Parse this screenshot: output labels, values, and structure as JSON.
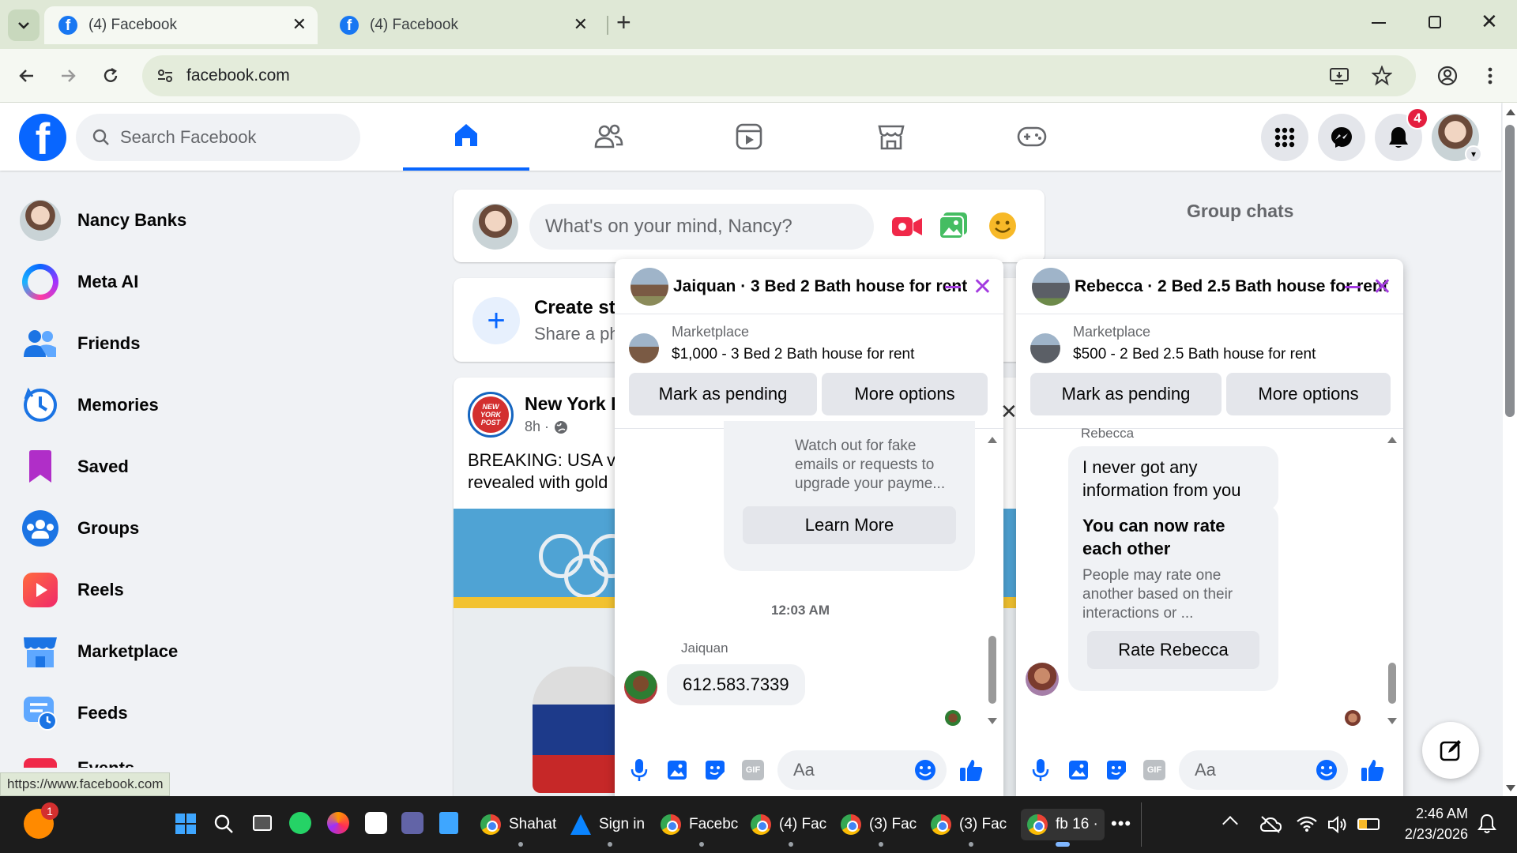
{
  "browser": {
    "tabs": [
      {
        "title": "(4) Facebook",
        "active": true
      },
      {
        "title": "(4) Facebook",
        "active": false
      }
    ],
    "new_tab": "+",
    "url": "facebook.com",
    "status_url": "https://www.facebook.com"
  },
  "fb": {
    "search_placeholder": "Search Facebook",
    "notifications_count": "4",
    "nav_tabs": [
      "home-icon",
      "friends-icon",
      "video-icon",
      "marketplace-icon",
      "gaming-icon"
    ]
  },
  "sidebar": {
    "items": [
      {
        "label": "Nancy Banks",
        "icon": "avatar"
      },
      {
        "label": "Meta AI",
        "icon": "meta-ai-icon"
      },
      {
        "label": "Friends",
        "icon": "friends-icon"
      },
      {
        "label": "Memories",
        "icon": "memories-icon"
      },
      {
        "label": "Saved",
        "icon": "saved-icon"
      },
      {
        "label": "Groups",
        "icon": "groups-icon"
      },
      {
        "label": "Reels",
        "icon": "reels-icon"
      },
      {
        "label": "Marketplace",
        "icon": "marketplace-icon"
      },
      {
        "label": "Feeds",
        "icon": "feeds-icon"
      },
      {
        "label": "Events",
        "icon": "events-icon"
      }
    ]
  },
  "composer": {
    "placeholder": "What's on your mind, Nancy?"
  },
  "story": {
    "title": "Create st",
    "subtitle": "Share a ph"
  },
  "post": {
    "author": "New York P",
    "time": "8h ·",
    "text_line1": "BREAKING: USA vs.",
    "text_line2": "revealed with gold",
    "logo_text": "NEW YORK POST"
  },
  "right_panel": {
    "group_chats": "Group chats"
  },
  "chat1": {
    "title": "Jaiquan · 3 Bed 2 Bath house for rent",
    "market_label": "Marketplace",
    "listing": "$1,000 - 3 Bed 2 Bath house for rent",
    "mark_pending": "Mark as pending",
    "more_options": "More options",
    "warning_text": "Watch out for fake emails or requests to upgrade your payme...",
    "learn_more": "Learn More",
    "timestamp": "12:03 AM",
    "sender": "Jaiquan",
    "message": "612.583.7339",
    "input_placeholder": "Aa"
  },
  "chat2": {
    "title": "Rebecca · 2 Bed 2.5 Bath house for rent",
    "market_label": "Marketplace",
    "listing": "$500 - 2 Bed 2.5 Bath house for rent",
    "mark_pending": "Mark as pending",
    "more_options": "More options",
    "sender": "Rebecca",
    "message": "I never got any information from you",
    "rate_title": "You can now rate each other",
    "rate_body": "People may rate one another based on their interactions or ...",
    "rate_button": "Rate Rebecca",
    "input_placeholder": "Aa"
  },
  "taskbar": {
    "items": [
      {
        "label": "Shahat"
      },
      {
        "label": "Sign in"
      },
      {
        "label": "Facebc"
      },
      {
        "label": "(4) Fac"
      },
      {
        "label": "(3) Fac"
      },
      {
        "label": "(3) Fac"
      },
      {
        "label": "fb 16 ·"
      }
    ],
    "time": "2:46 AM",
    "date": "2/23/2026",
    "notif_count": "1"
  },
  "colors": {
    "fb_blue": "#0866ff",
    "chat_close": "#a33be0",
    "badge_red": "#e41e3f"
  }
}
